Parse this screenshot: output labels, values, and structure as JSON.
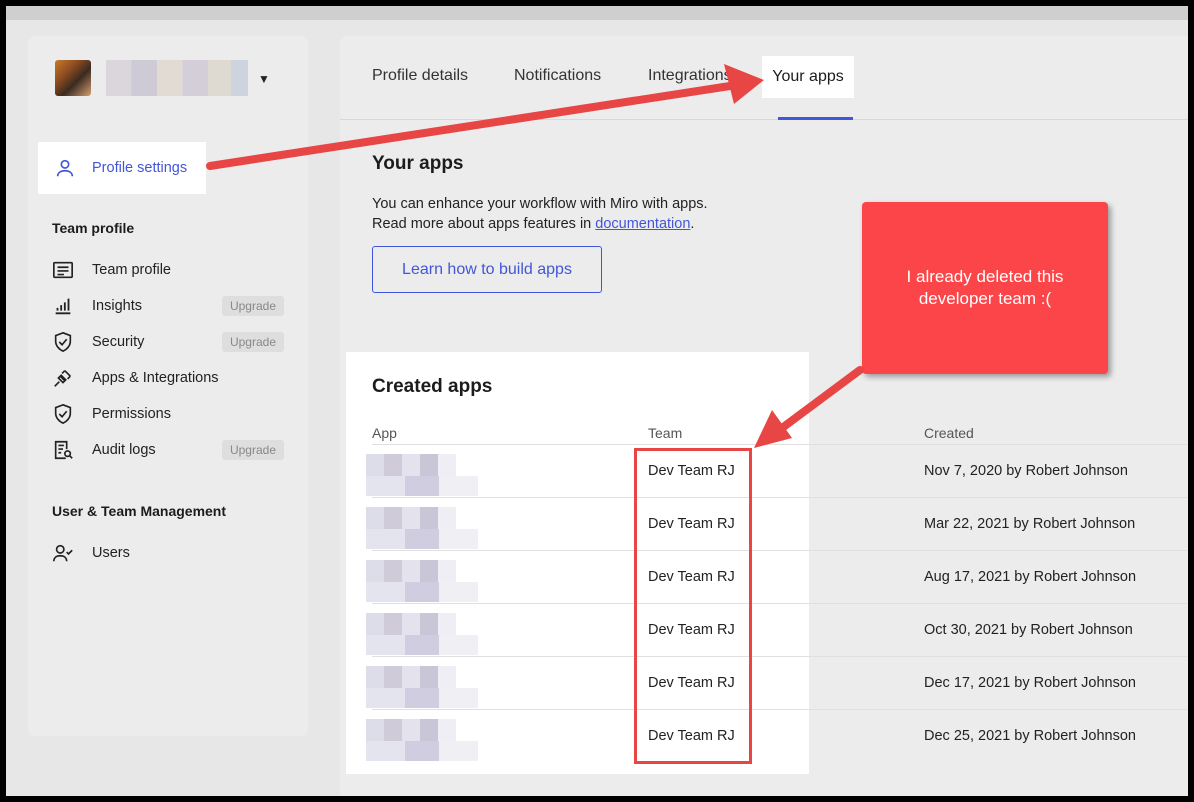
{
  "sidebar": {
    "profile_settings": "Profile settings",
    "team_profile_heading": "Team profile",
    "items": [
      {
        "label": "Team profile",
        "badge": ""
      },
      {
        "label": "Insights",
        "badge": "Upgrade"
      },
      {
        "label": "Security",
        "badge": "Upgrade"
      },
      {
        "label": "Apps & Integrations",
        "badge": ""
      },
      {
        "label": "Permissions",
        "badge": ""
      },
      {
        "label": "Audit logs",
        "badge": "Upgrade"
      }
    ],
    "user_mgmt_heading": "User & Team Management",
    "users_label": "Users"
  },
  "tabs": {
    "profile_details": "Profile details",
    "notifications": "Notifications",
    "integrations": "Integrations",
    "your_apps": "Your apps"
  },
  "main": {
    "heading": "Your apps",
    "desc_line1": "You can enhance your workflow with Miro with apps.",
    "desc_line2_prefix": "Read more about apps features in ",
    "desc_link": "documentation",
    "desc_line2_suffix": ".",
    "learn_button": "Learn how to build apps",
    "created_heading": "Created apps",
    "columns": {
      "app": "App",
      "team": "Team",
      "created": "Created"
    },
    "rows": [
      {
        "team": "Dev Team RJ",
        "created": "Nov 7, 2020 by Robert Johnson"
      },
      {
        "team": "Dev Team RJ",
        "created": "Mar 22, 2021 by Robert Johnson"
      },
      {
        "team": "Dev Team RJ",
        "created": "Aug 17, 2021 by Robert Johnson"
      },
      {
        "team": "Dev Team RJ",
        "created": "Oct 30, 2021 by Robert Johnson"
      },
      {
        "team": "Dev Team RJ",
        "created": "Dec 17, 2021 by Robert Johnson"
      },
      {
        "team": "Dev Team RJ",
        "created": "Dec 25, 2021 by Robert Johnson"
      }
    ]
  },
  "annotation": {
    "callout_line1": "I already deleted this",
    "callout_line2": "developer team :("
  },
  "colors": {
    "accent": "#4256d8",
    "annotation_red": "#fb4548"
  }
}
